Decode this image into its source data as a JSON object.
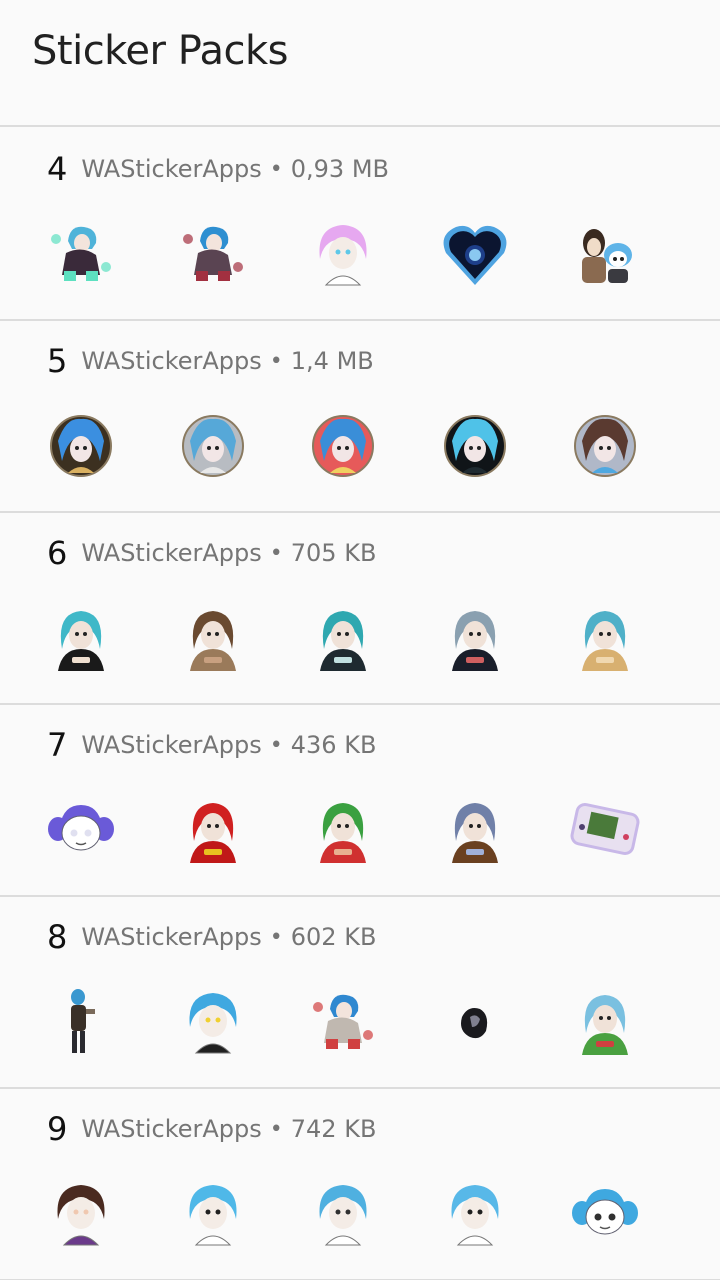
{
  "app_bar": {
    "title": "Sticker Packs"
  },
  "packs": [
    {
      "name": "4",
      "publisher": "WAStickerApps",
      "separator": "•",
      "size": "0,93 MB",
      "stickers": [
        {
          "icon": "girl-teal-aura-sticker",
          "style": "figure",
          "hair": "#4fb3d9",
          "body": "#3a2a3a",
          "accent": "#5de0c0"
        },
        {
          "icon": "boy-crouching-sticker",
          "style": "figure",
          "hair": "#2e8fd1",
          "body": "#5a4452",
          "accent": "#a23040"
        },
        {
          "icon": "pink-hair-girl-sticker",
          "style": "head",
          "hair": "#e6a8f0",
          "body": "#ffffff",
          "accent": "#5ec8e8"
        },
        {
          "icon": "blue-heart-badge-sticker",
          "style": "heart",
          "hair": "#1e3f8a",
          "body": "#0b1530",
          "accent": "#4ea3e0"
        },
        {
          "icon": "two-friends-sticker",
          "style": "duo",
          "hair": "#3a2a20",
          "body": "#8a6a50",
          "accent": "#5fb4e8"
        }
      ]
    },
    {
      "name": "5",
      "publisher": "WAStickerApps",
      "separator": "•",
      "size": "1,4 MB",
      "stickers": [
        {
          "icon": "blue-hair-round-portrait",
          "style": "round",
          "hair": "#3b8fe0",
          "body": "#3c3020",
          "accent": "#d9b060"
        },
        {
          "icon": "grey-round-portrait",
          "style": "round",
          "hair": "#56a8d8",
          "body": "#b8bcc2",
          "accent": "#e8e8e8"
        },
        {
          "icon": "mask-round-portrait",
          "style": "round",
          "hair": "#3a8ed8",
          "body": "#e65a5a",
          "accent": "#f0d060"
        },
        {
          "icon": "dark-round-portrait",
          "style": "round",
          "hair": "#4fc2e8",
          "body": "#101418",
          "accent": "#1f2a30"
        },
        {
          "icon": "duo-round-portrait",
          "style": "round",
          "hair": "#5a3a30",
          "body": "#b0b8c8",
          "accent": "#4fa8e0"
        }
      ]
    },
    {
      "name": "6",
      "publisher": "WAStickerApps",
      "separator": "•",
      "size": "705 KB",
      "stickers": [
        {
          "icon": "smile-shirt-girl-sticker",
          "style": "bust",
          "hair": "#3fb8c8",
          "body": "#1a1a1a",
          "accent": "#f0e0d0"
        },
        {
          "icon": "long-hair-man-sticker",
          "style": "bust",
          "hair": "#6a4a30",
          "body": "#9a7a5a",
          "accent": "#c8a080"
        },
        {
          "icon": "sad-teal-girl-sticker",
          "style": "bust",
          "hair": "#2fa8b0",
          "body": "#1e2a30",
          "accent": "#c0e0e0"
        },
        {
          "icon": "hooded-figure-sticker",
          "style": "bust",
          "hair": "#8aa0b0",
          "body": "#1a1e2a",
          "accent": "#d06060"
        },
        {
          "icon": "girl-holding-cat-sticker",
          "style": "bust",
          "hair": "#4fb0c8",
          "body": "#d8b070",
          "accent": "#f0d8b0"
        }
      ]
    },
    {
      "name": "7",
      "publisher": "WAStickerApps",
      "separator": "•",
      "size": "436 KB",
      "stickers": [
        {
          "icon": "purple-pigtails-sticker",
          "style": "chibi",
          "hair": "#6a5ad8",
          "body": "#ffffff",
          "accent": "#e0e0f0"
        },
        {
          "icon": "red-hood-text-sticker",
          "style": "bust",
          "hair": "#d02020",
          "body": "#c01818",
          "accent": "#e8c020"
        },
        {
          "icon": "green-hair-boy-sticker",
          "style": "bust",
          "hair": "#3aa040",
          "body": "#d03030",
          "accent": "#e8b090"
        },
        {
          "icon": "girl-with-cake-sticker",
          "style": "bust",
          "hair": "#7080a8",
          "body": "#6a4020",
          "accent": "#a0b0d8"
        },
        {
          "icon": "gameboy-console-sticker",
          "style": "gameboy",
          "hair": "#c8b8e8",
          "body": "#e8e0f0",
          "accent": "#4a7a3a"
        }
      ]
    },
    {
      "name": "8",
      "publisher": "WAStickerApps",
      "separator": "•",
      "size": "602 KB",
      "stickers": [
        {
          "icon": "standing-figure-sticker",
          "style": "standing",
          "hair": "#3a98d0",
          "body": "#3a3028",
          "accent": "#2a2a30"
        },
        {
          "icon": "sunflower-girl-sticker",
          "style": "head",
          "hair": "#3fa8e0",
          "body": "#202020",
          "accent": "#f0d030"
        },
        {
          "icon": "small-sitting-sticker",
          "style": "figure",
          "hair": "#2f88d0",
          "body": "#c0b8b0",
          "accent": "#d04040"
        },
        {
          "icon": "dark-blob-sticker",
          "style": "blob",
          "hair": "#1a1a1e",
          "body": "#404048",
          "accent": "#808090"
        },
        {
          "icon": "green-dress-sticker",
          "style": "bust",
          "hair": "#7ac0e0",
          "body": "#4aa040",
          "accent": "#d04040"
        }
      ]
    },
    {
      "name": "9",
      "publisher": "WAStickerApps",
      "separator": "•",
      "size": "742 KB",
      "stickers": [
        {
          "icon": "brown-hair-girl-sticker",
          "style": "head",
          "hair": "#4a2a20",
          "body": "#6a3a8a",
          "accent": "#f0c8b0"
        },
        {
          "icon": "masked-blue-hair-sticker",
          "style": "head",
          "hair": "#4fb8e8",
          "body": "#ffffff",
          "accent": "#202020"
        },
        {
          "icon": "messy-blue-hair-sticker",
          "style": "head",
          "hair": "#4fb0e0",
          "body": "#ffffff",
          "accent": "#303030"
        },
        {
          "icon": "bun-hair-sticker",
          "style": "head",
          "hair": "#58b8e8",
          "body": "#ffffff",
          "accent": "#202020"
        },
        {
          "icon": "blue-pigtails-sticker",
          "style": "chibi",
          "hair": "#3fa8e0",
          "body": "#ffffff",
          "accent": "#303030"
        }
      ]
    }
  ]
}
